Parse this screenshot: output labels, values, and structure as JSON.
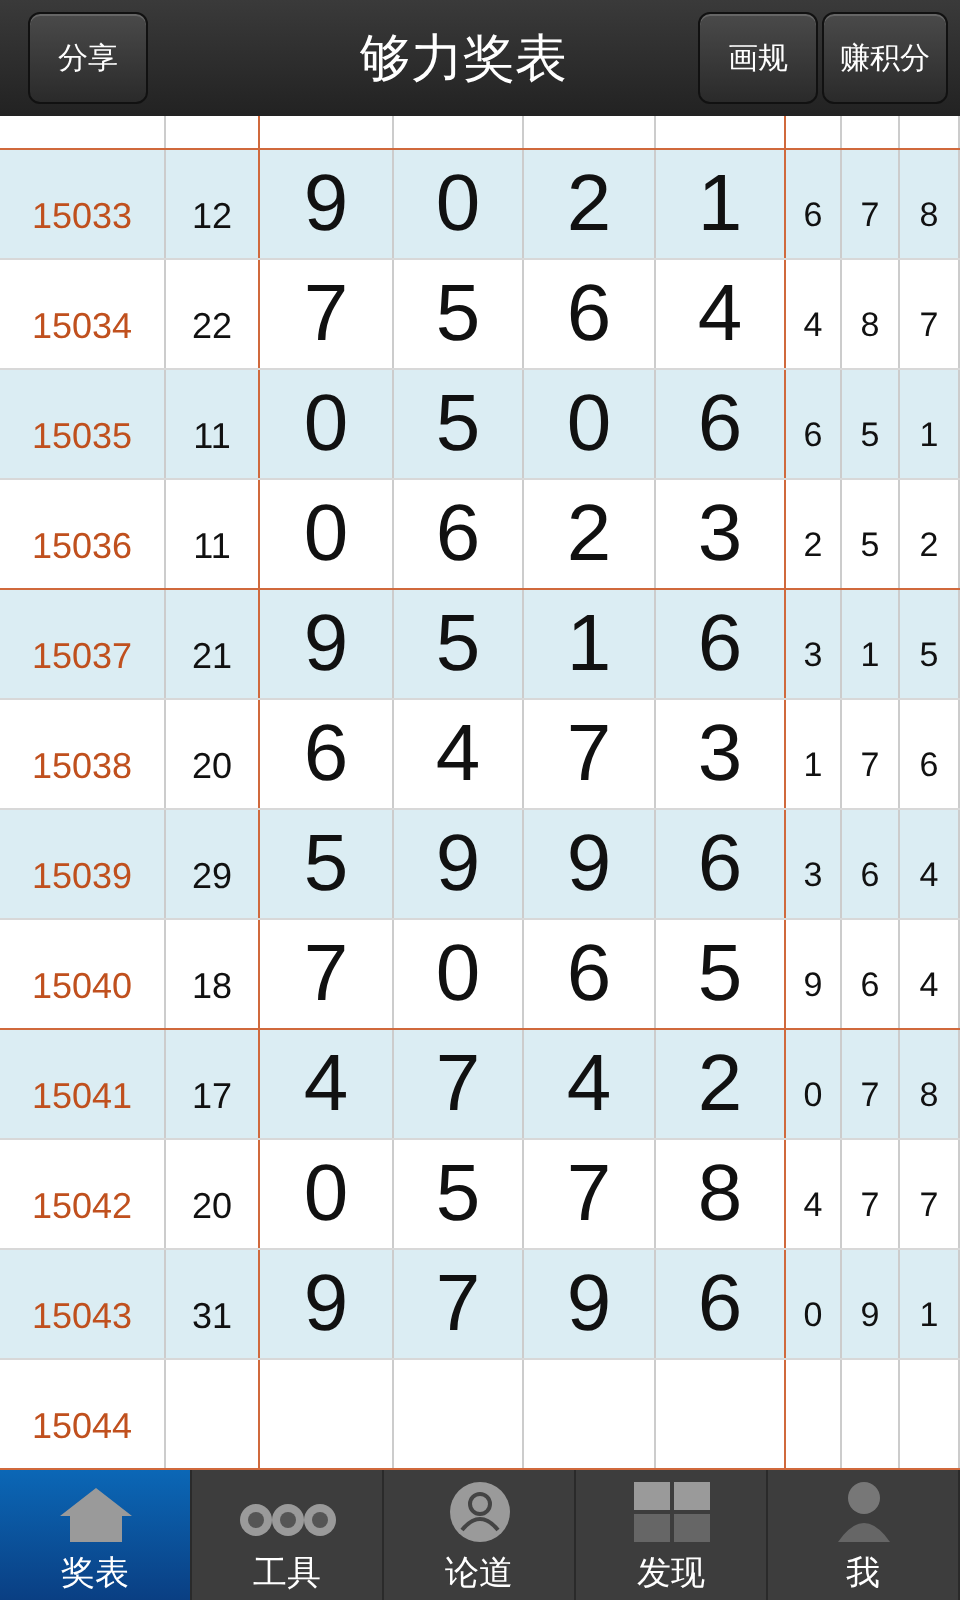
{
  "header": {
    "title": "够力奖表",
    "left_button": "分享",
    "right_buttons": [
      "画规",
      "赚积分"
    ]
  },
  "rows": [
    {
      "issue": "15033",
      "sum": "12",
      "digits": [
        "9",
        "0",
        "2",
        "1"
      ],
      "extra": [
        "6",
        "7",
        "8"
      ]
    },
    {
      "issue": "15034",
      "sum": "22",
      "digits": [
        "7",
        "5",
        "6",
        "4"
      ],
      "extra": [
        "4",
        "8",
        "7"
      ]
    },
    {
      "issue": "15035",
      "sum": "11",
      "digits": [
        "0",
        "5",
        "0",
        "6"
      ],
      "extra": [
        "6",
        "5",
        "1"
      ]
    },
    {
      "issue": "15036",
      "sum": "11",
      "digits": [
        "0",
        "6",
        "2",
        "3"
      ],
      "extra": [
        "2",
        "5",
        "2"
      ]
    },
    {
      "issue": "15037",
      "sum": "21",
      "digits": [
        "9",
        "5",
        "1",
        "6"
      ],
      "extra": [
        "3",
        "1",
        "5"
      ]
    },
    {
      "issue": "15038",
      "sum": "20",
      "digits": [
        "6",
        "4",
        "7",
        "3"
      ],
      "extra": [
        "1",
        "7",
        "6"
      ]
    },
    {
      "issue": "15039",
      "sum": "29",
      "digits": [
        "5",
        "9",
        "9",
        "6"
      ],
      "extra": [
        "3",
        "6",
        "4"
      ]
    },
    {
      "issue": "15040",
      "sum": "18",
      "digits": [
        "7",
        "0",
        "6",
        "5"
      ],
      "extra": [
        "9",
        "6",
        "4"
      ]
    },
    {
      "issue": "15041",
      "sum": "17",
      "digits": [
        "4",
        "7",
        "4",
        "2"
      ],
      "extra": [
        "0",
        "7",
        "8"
      ]
    },
    {
      "issue": "15042",
      "sum": "20",
      "digits": [
        "0",
        "5",
        "7",
        "8"
      ],
      "extra": [
        "4",
        "7",
        "7"
      ]
    },
    {
      "issue": "15043",
      "sum": "31",
      "digits": [
        "9",
        "7",
        "9",
        "6"
      ],
      "extra": [
        "0",
        "9",
        "1"
      ]
    },
    {
      "issue": "15044"
    }
  ],
  "tabs": [
    {
      "label": "奖表",
      "kind": "house",
      "selected": true
    },
    {
      "label": "工具",
      "kind": "dots",
      "selected": false
    },
    {
      "label": "论道",
      "kind": "contact",
      "selected": false
    },
    {
      "label": "发现",
      "kind": "grid",
      "selected": false
    },
    {
      "label": "我",
      "kind": "person",
      "selected": false
    }
  ]
}
